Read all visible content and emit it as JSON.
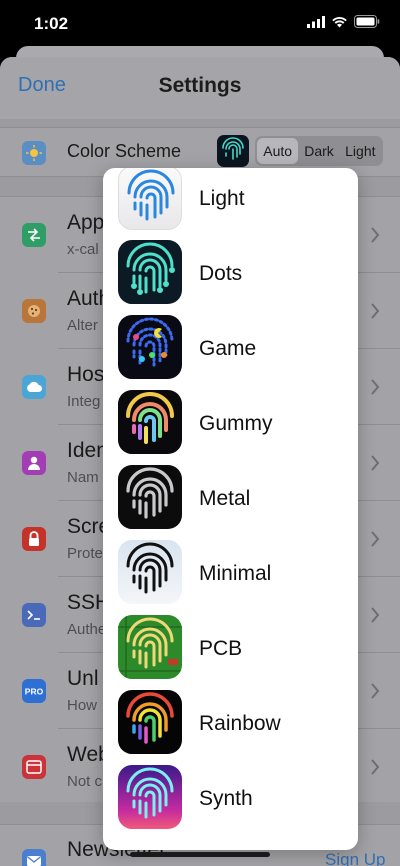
{
  "status": {
    "time": "1:02"
  },
  "nav": {
    "done": "Done",
    "title": "Settings"
  },
  "color_scheme": {
    "label": "Color Scheme",
    "segments": [
      "Auto",
      "Dark",
      "Light"
    ],
    "selected": "Auto"
  },
  "rows": [
    {
      "title": "App",
      "subtitle": "x-cal",
      "icon": "swap-arrows-icon",
      "color": "#2f9e66"
    },
    {
      "title": "Auth",
      "subtitle": "Alter",
      "icon": "cookie-icon",
      "color": "#b8763a"
    },
    {
      "title": "Hos",
      "subtitle": "Integ",
      "icon": "cloud-icon",
      "color": "#4ba6d6"
    },
    {
      "title": "Iden",
      "subtitle": "Nam",
      "icon": "person-icon",
      "color": "#a33db4"
    },
    {
      "title": "Scre",
      "subtitle": "Prote",
      "icon": "lock-icon",
      "color": "#c4322a"
    },
    {
      "title": "SSH",
      "subtitle": "Authe",
      "icon": "terminal-icon",
      "color": "#4a69b8"
    },
    {
      "title": "Unl",
      "subtitle": "How",
      "icon": "pro-badge-icon",
      "color": "#2e6fd3"
    },
    {
      "title": "Web",
      "subtitle": "Not c",
      "icon": "browser-icon",
      "color": "#c9333a"
    }
  ],
  "newsletter": {
    "title": "Newsletter",
    "action": "Sign Up"
  },
  "themes": [
    {
      "name": "Light",
      "icon": "fingerprint-light-icon"
    },
    {
      "name": "Dots",
      "icon": "fingerprint-dots-icon"
    },
    {
      "name": "Game",
      "icon": "fingerprint-game-icon"
    },
    {
      "name": "Gummy",
      "icon": "fingerprint-gummy-icon"
    },
    {
      "name": "Metal",
      "icon": "fingerprint-metal-icon"
    },
    {
      "name": "Minimal",
      "icon": "fingerprint-minimal-icon"
    },
    {
      "name": "PCB",
      "icon": "fingerprint-pcb-icon"
    },
    {
      "name": "Rainbow",
      "icon": "fingerprint-rainbow-icon"
    },
    {
      "name": "Synth",
      "icon": "fingerprint-synth-icon"
    }
  ]
}
